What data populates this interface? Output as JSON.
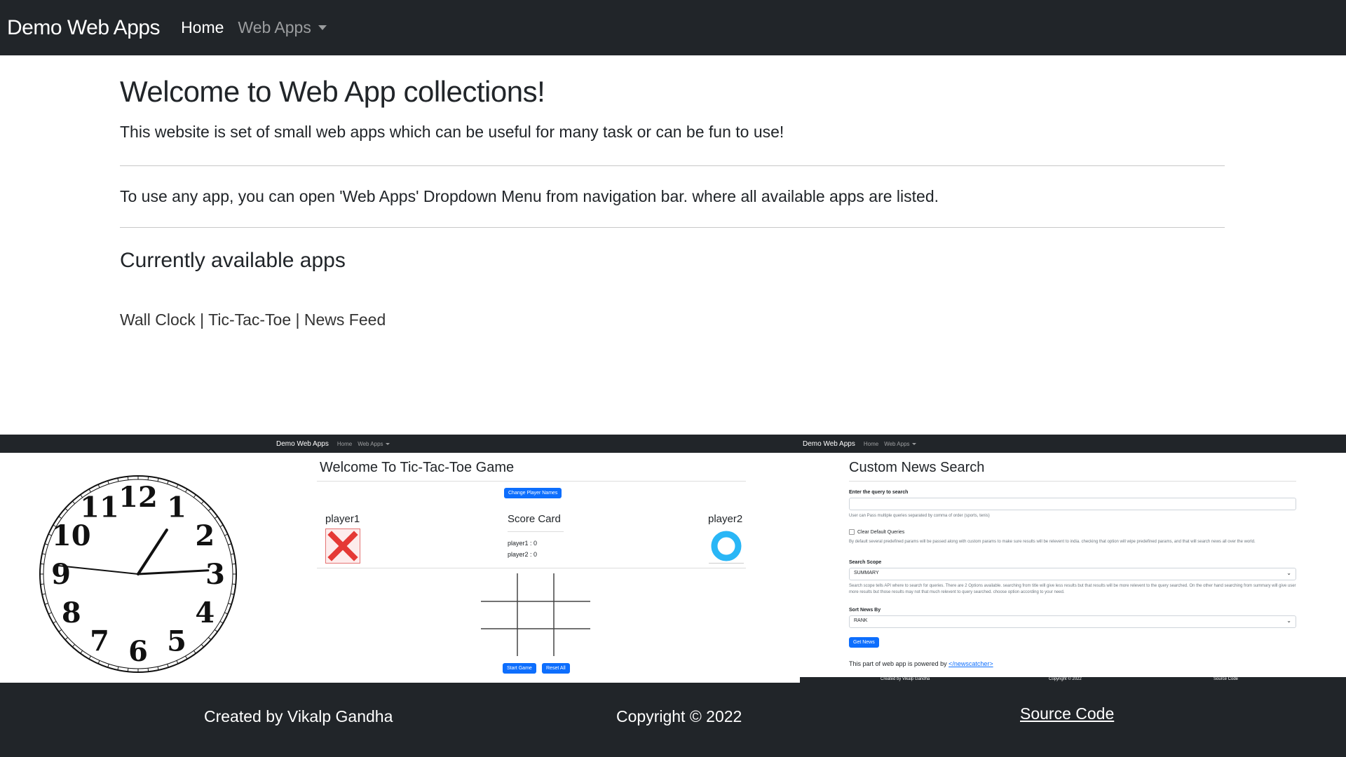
{
  "navbar": {
    "brand": "Demo Web Apps",
    "home": "Home",
    "web_apps": "Web Apps"
  },
  "main": {
    "title": "Welcome to Web App collections!",
    "lead": "This website is set of small web apps which can be useful for many task or can be fun to use!",
    "instruction": "To use any app, you can open 'Web Apps' Dropdown Menu from navigation bar. where all available apps are listed.",
    "apps_heading": "Currently available apps",
    "apps": [
      "Wall Clock",
      "Tic-Tac-Toe",
      "News Feed"
    ],
    "separator": "|"
  },
  "screenshots": {
    "mini_nav": {
      "brand": "Demo Web Apps",
      "home": "Home",
      "web_apps": "Web Apps"
    },
    "clock": {
      "numbers": [
        "12",
        "1",
        "2",
        "3",
        "4",
        "5",
        "6",
        "7",
        "8",
        "9",
        "10",
        "11"
      ],
      "hour": 1.1,
      "minute": 14.5,
      "second": 46
    },
    "ttt": {
      "title": "Welcome To Tic-Tac-Toe Game",
      "change_names": "Change Player Names",
      "player1": "player1",
      "player2": "player2",
      "score_title": "Score Card",
      "score1": "player1 : 0",
      "score2": "player2 : 0",
      "start": "Start Game",
      "reset": "Reset All"
    },
    "news": {
      "title": "Custom News Search",
      "query_label": "Enter the query to search",
      "query_help": "User can Pass multiple queries separated by comma of order (sports, tenis)",
      "clear_label": "Clear Default Queries",
      "clear_help": "By default several predefined params will be passed along with custom params to make sure results will be relevent to india. checking that option will wipe predefined params, and that will search news all over the world.",
      "scope_label": "Search Scope",
      "scope_value": "SUMMARY",
      "scope_help": "Search scope tells API where to search for queries. There are 2 Options available. searching from title will give less results but that results will be more relevent to the query searched. On the other hand searching from summary will give user more results but those results may not that much relevent to query searched. choose option according to your need.",
      "sort_label": "Sort News By",
      "sort_value": "RANK",
      "get_news": "Get News",
      "powered_text": "This part of web app is powered by ",
      "powered_link": "</newscatcher>",
      "mini_footer": [
        "Created by Vikalp Gandha",
        "Copyright © 2022",
        "Source Code"
      ]
    }
  },
  "footer": {
    "created": "Created by Vikalp Gandha",
    "copyright": "Copyright © 2022",
    "source": "Source Code"
  },
  "colors": {
    "dark": "#212529",
    "primary": "#0d6efd",
    "x_red": "#e53935",
    "o_blue": "#29b6f6"
  }
}
